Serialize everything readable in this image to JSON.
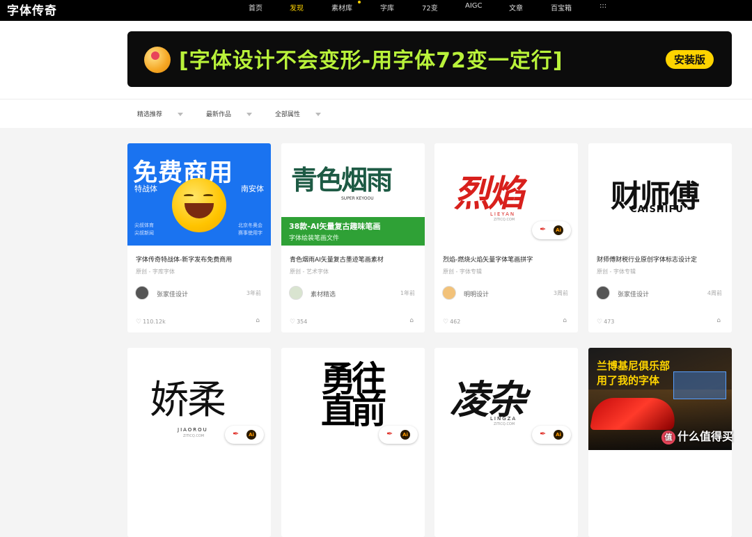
{
  "app": {
    "logo": "字体传奇"
  },
  "nav": {
    "items": [
      {
        "label": "首页",
        "active": false
      },
      {
        "label": "发现",
        "active": true
      },
      {
        "label": "素材库",
        "active": false
      },
      {
        "label": "字库",
        "active": false
      },
      {
        "label": "72变",
        "active": false
      },
      {
        "label": "AIGC",
        "active": false
      },
      {
        "label": "文章",
        "active": false
      },
      {
        "label": "百宝箱",
        "active": false
      },
      {
        "label": ":::",
        "active": false
      }
    ]
  },
  "banner": {
    "text": "[字体设计不会变形-用字体72变一定行]",
    "button": "安装版"
  },
  "filters": [
    "精选推荐",
    "最新作品",
    "全部属性"
  ],
  "cards": [
    {
      "thumb_type": "free",
      "thumb": {
        "headline": "免费商用",
        "left_label": "特战体",
        "right_label": "南安体",
        "bl1": "尖叔体育",
        "bl2": "尖叔新闻",
        "br1": "北京冬奥会",
        "br2": "赛事使用字"
      },
      "title": "字体传奇特战体-新字发布免费商用",
      "subtitle": "原创 - 字库字体",
      "author": "张家佳设计",
      "time": "3年前",
      "likes": "110.12k"
    },
    {
      "thumb_type": "green",
      "thumb": {
        "headline": "青色烟雨",
        "brand": "SUPER KEYOOU",
        "caption1": "38款-AI矢量复古趣味笔画",
        "caption2": "字体绘装笔画文件"
      },
      "title": "青色烟雨AI矢量复古墨迹笔画素材",
      "subtitle": "原创 - 艺术字体",
      "author": "素材精选",
      "time": "1年前",
      "likes": "354"
    },
    {
      "thumb_type": "red",
      "thumb": {
        "headline": "烈焰",
        "pinyin": "LIEYAN",
        "domain": "ZITICQ.COM"
      },
      "title": "烈焰-燃烧火焰矢量字体笔画拼字",
      "subtitle": "原创 - 字体专辑",
      "author": "明明设计",
      "time": "3周前",
      "likes": "462"
    },
    {
      "thumb_type": "black",
      "thumb": {
        "headline": "财师傅",
        "pinyin": "CAISHIFU"
      },
      "title": "财师傅财税行业原创字体标志设计定",
      "subtitle": "原创 - 字体专辑",
      "author": "张家佳设计",
      "time": "4周前",
      "likes": "473"
    },
    {
      "thumb_type": "brush",
      "thumb": {
        "headline": "娇柔",
        "pinyin": "JIAOROU",
        "domain": "ZITICQ.COM"
      }
    },
    {
      "thumb_type": "heavy",
      "thumb": {
        "headline": "勇往直前"
      }
    },
    {
      "thumb_type": "ink",
      "thumb": {
        "headline": "凌杂",
        "pinyin": "LINGZA",
        "domain": "ZITICQ.COM"
      }
    },
    {
      "thumb_type": "photo",
      "thumb": {
        "line1": "兰博基尼俱乐部",
        "line2": "用了我的字体"
      }
    }
  ],
  "watermark": "什么值得买",
  "colors": {
    "accent": "#ffd400",
    "banner_text": "#b9f23a",
    "blue": "#1a73f0",
    "green": "#2fa136",
    "red": "#e0332c"
  }
}
